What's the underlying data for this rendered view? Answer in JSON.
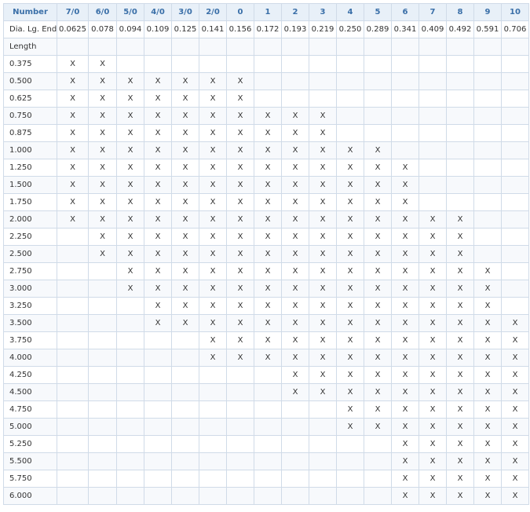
{
  "header": {
    "label": "Number",
    "columns": [
      "7/0",
      "6/0",
      "5/0",
      "4/0",
      "3/0",
      "2/0",
      "0",
      "1",
      "2",
      "3",
      "4",
      "5",
      "6",
      "7",
      "8",
      "9",
      "10"
    ]
  },
  "diameter_row": {
    "label": "Dia. Lg. End",
    "values": [
      "0.0625",
      "0.078",
      "0.094",
      "0.109",
      "0.125",
      "0.141",
      "0.156",
      "0.172",
      "0.193",
      "0.219",
      "0.250",
      "0.289",
      "0.341",
      "0.409",
      "0.492",
      "0.591",
      "0.706"
    ]
  },
  "length_label": "Length",
  "mark": "X",
  "rows": [
    {
      "length": "0.375",
      "from": 0,
      "to": 1
    },
    {
      "length": "0.500",
      "from": 0,
      "to": 6
    },
    {
      "length": "0.625",
      "from": 0,
      "to": 6
    },
    {
      "length": "0.750",
      "from": 0,
      "to": 9
    },
    {
      "length": "0.875",
      "from": 0,
      "to": 9
    },
    {
      "length": "1.000",
      "from": 0,
      "to": 11
    },
    {
      "length": "1.250",
      "from": 0,
      "to": 12
    },
    {
      "length": "1.500",
      "from": 0,
      "to": 12
    },
    {
      "length": "1.750",
      "from": 0,
      "to": 12
    },
    {
      "length": "2.000",
      "from": 0,
      "to": 14
    },
    {
      "length": "2.250",
      "from": 1,
      "to": 14
    },
    {
      "length": "2.500",
      "from": 1,
      "to": 14
    },
    {
      "length": "2.750",
      "from": 2,
      "to": 15
    },
    {
      "length": "3.000",
      "from": 2,
      "to": 15
    },
    {
      "length": "3.250",
      "from": 3,
      "to": 15
    },
    {
      "length": "3.500",
      "from": 3,
      "to": 16
    },
    {
      "length": "3.750",
      "from": 5,
      "to": 16
    },
    {
      "length": "4.000",
      "from": 5,
      "to": 16
    },
    {
      "length": "4.250",
      "from": 8,
      "to": 16
    },
    {
      "length": "4.500",
      "from": 8,
      "to": 16
    },
    {
      "length": "4.750",
      "from": 10,
      "to": 16
    },
    {
      "length": "5.000",
      "from": 10,
      "to": 16
    },
    {
      "length": "5.250",
      "from": 12,
      "to": 16
    },
    {
      "length": "5.500",
      "from": 12,
      "to": 16
    },
    {
      "length": "5.750",
      "from": 12,
      "to": 16
    },
    {
      "length": "6.000",
      "from": 12,
      "to": 16
    }
  ]
}
